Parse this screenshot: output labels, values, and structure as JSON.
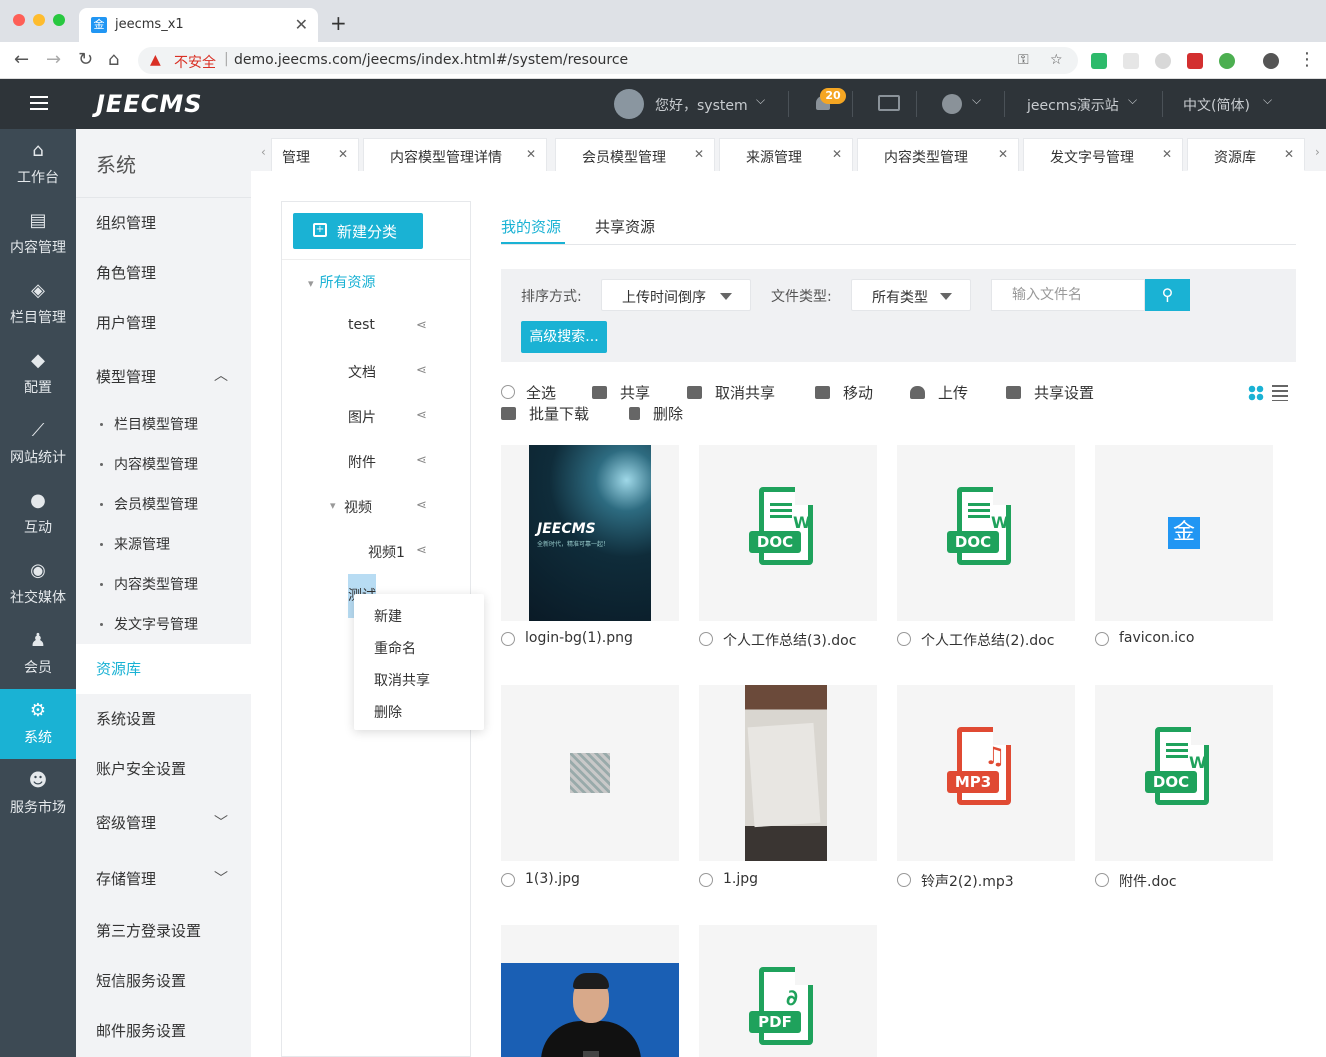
{
  "browser": {
    "tab_title": "jeecms_x1",
    "tab_favicon": "金",
    "close_symbol": "✕",
    "new_tab_symbol": "+",
    "insecure_label": "不安全",
    "url": "demo.jeecms.com/jeecms/index.html#/system/resource",
    "back_symbol": "←",
    "forward_symbol": "→",
    "reload_symbol": "↻",
    "home_symbol": "⌂",
    "warn_symbol": "▲",
    "key_symbol": "⚿",
    "star_symbol": "☆",
    "menu_symbol": "⋮",
    "colors": {
      "insecure": "#d93025"
    }
  },
  "header": {
    "logo": "JEECMS",
    "greeting": "您好，system",
    "notification_count": "20",
    "site_name": "jeecms演示站",
    "language": "中文(简体)",
    "caret": "⌵",
    "colors": {
      "background": "#2e3439",
      "badge": "#f5a623"
    }
  },
  "leftnav": {
    "items": [
      {
        "label": "工作台",
        "icon": "home-icon",
        "glyph": "⌂"
      },
      {
        "label": "内容管理",
        "icon": "document-icon",
        "glyph": "▤"
      },
      {
        "label": "栏目管理",
        "icon": "layers-icon",
        "glyph": "◈"
      },
      {
        "label": "配置",
        "icon": "cube-icon",
        "glyph": "◆"
      },
      {
        "label": "网站统计",
        "icon": "chart-icon",
        "glyph": "⟋"
      },
      {
        "label": "互动",
        "icon": "chat-icon",
        "glyph": "●"
      },
      {
        "label": "社交媒体",
        "icon": "target-icon",
        "glyph": "◉"
      },
      {
        "label": "会员",
        "icon": "user-icon",
        "glyph": "♟"
      },
      {
        "label": "系统",
        "icon": "gear-icon",
        "glyph": "⚙"
      },
      {
        "label": "服务市场",
        "icon": "service-icon",
        "glyph": "☻"
      }
    ],
    "colors": {
      "background": "#3d4a54",
      "active": "#1ab2d4"
    }
  },
  "subnav": {
    "title": "系统",
    "items": {
      "org": "组织管理",
      "role": "角色管理",
      "user": "用户管理",
      "model": "模型管理",
      "model_children": [
        "栏目模型管理",
        "内容模型管理",
        "会员模型管理",
        "来源管理",
        "内容类型管理",
        "发文字号管理"
      ],
      "resource": "资源库",
      "system_settings": "系统设置",
      "account_security": "账户安全设置",
      "classified": "密级管理",
      "storage": "存储管理",
      "third_party_login": "第三方登录设置",
      "sms": "短信服务设置",
      "mail": "邮件服务设置"
    },
    "chevron_up": "︿",
    "chevron_down": "﹀"
  },
  "page_tabs": {
    "left_arrow": "‹",
    "right_arrow": "›",
    "tabs": [
      "管理",
      "内容模型管理详情",
      "会员模型管理",
      "来源管理",
      "内容类型管理",
      "发文字号管理",
      "资源库"
    ]
  },
  "tree": {
    "new_category": "新建分类",
    "root": "所有资源",
    "nodes": [
      "test",
      "文档",
      "图片",
      "附件",
      "视频",
      "视频1",
      "测试"
    ],
    "expand_symbol": "▾",
    "share_symbol": "⋖",
    "context_menu": [
      "新建",
      "重命名",
      "取消共享",
      "删除"
    ]
  },
  "resource_tabs": {
    "mine": "我的资源",
    "shared": "共享资源"
  },
  "filters": {
    "sort_label": "排序方式:",
    "sort_value": "上传时间倒序",
    "type_label": "文件类型:",
    "type_value": "所有类型",
    "search_placeholder": "输入文件名",
    "search_symbol": "⚲",
    "advanced_search": "高级搜索..."
  },
  "actions": {
    "select_all": "全选",
    "share": "共享",
    "unshare": "取消共享",
    "move": "移动",
    "upload": "上传",
    "share_settings": "共享设置",
    "batch_download": "批量下载",
    "delete": "删除"
  },
  "files": [
    {
      "name": "login-bg(1).png",
      "kind": "image"
    },
    {
      "name": "个人工作总结(3).doc",
      "kind": "doc"
    },
    {
      "name": "个人工作总结(2).doc",
      "kind": "doc"
    },
    {
      "name": "favicon.ico",
      "kind": "icon"
    },
    {
      "name": "1(3).jpg",
      "kind": "image"
    },
    {
      "name": "1.jpg",
      "kind": "image"
    },
    {
      "name": "铃声2(2).mp3",
      "kind": "mp3"
    },
    {
      "name": "附件.doc",
      "kind": "doc"
    },
    {
      "name": "",
      "kind": "image"
    },
    {
      "name": "",
      "kind": "pdf"
    }
  ],
  "thumbs": {
    "jeecms_title": "JEECMS",
    "jeecms_sub": "全新时代，精准可靠一起！",
    "favicon_glyph": "金",
    "doc_badge": "DOC",
    "doc_w": "W",
    "mp3_badge": "MP3",
    "mp3_note": "♫",
    "pdf_badge": "PDF",
    "pdf_mark": "∂"
  },
  "colors": {
    "accent": "#1ab2d4",
    "doc": "#1fa25c",
    "mp3": "#e04a33",
    "pdf": "#1fa25c"
  }
}
